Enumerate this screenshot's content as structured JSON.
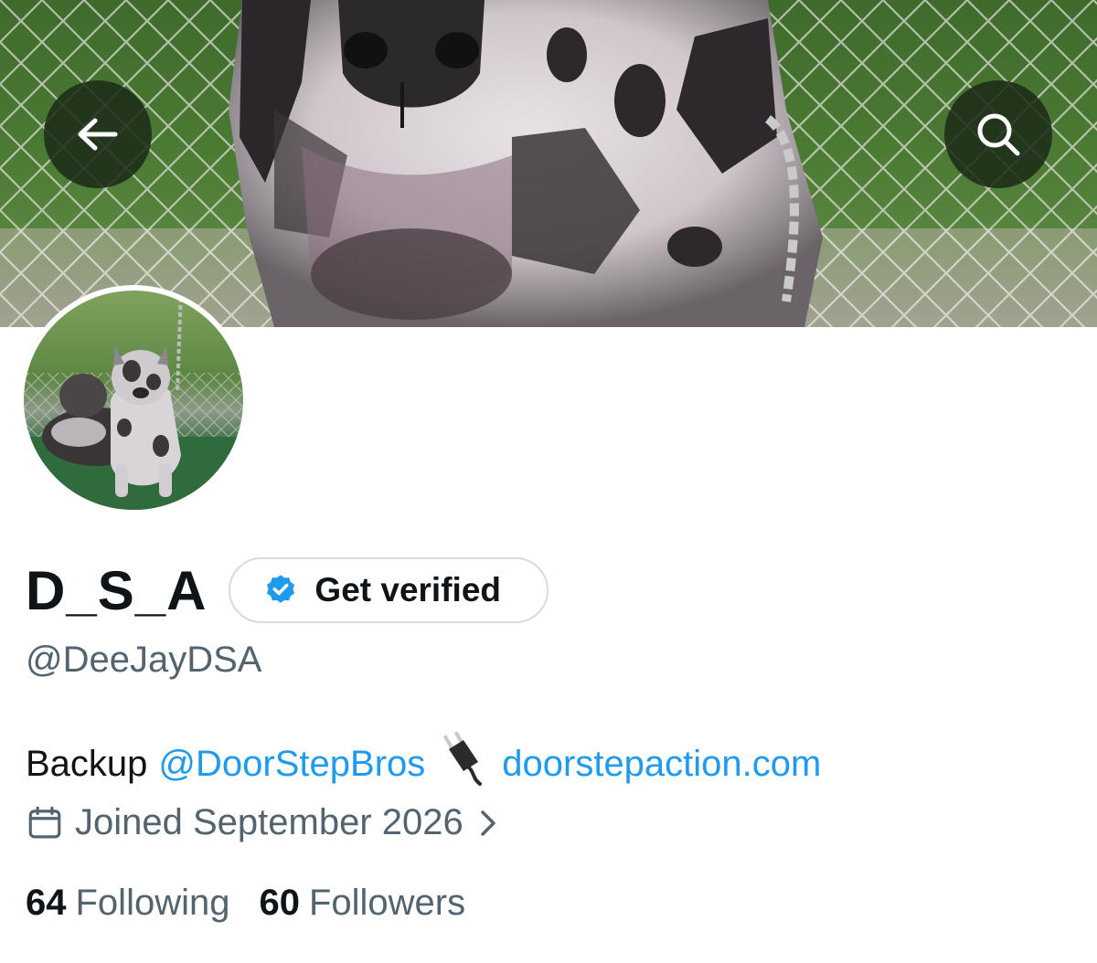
{
  "profile": {
    "display_name": "D_S_A",
    "handle": "@DeeJayDSA",
    "verify_button_label": "Get verified",
    "bio": {
      "prefix": "Backup",
      "mention": "@DoorStepBros",
      "link": "doorstepaction.com"
    },
    "joined": "Joined September 2026",
    "following_count": "64",
    "following_label": "Following",
    "followers_count": "60",
    "followers_label": "Followers"
  },
  "icons": {
    "back": "arrow-left-icon",
    "search": "search-icon",
    "verified": "verified-badge-icon",
    "plug": "electric-plug-emoji",
    "calendar": "calendar-icon",
    "chevron": "chevron-right-icon"
  },
  "colors": {
    "link": "#1d9bf0",
    "secondary_text": "#536471",
    "primary_text": "#0f1419",
    "verified_badge": "#1d9bf0"
  }
}
